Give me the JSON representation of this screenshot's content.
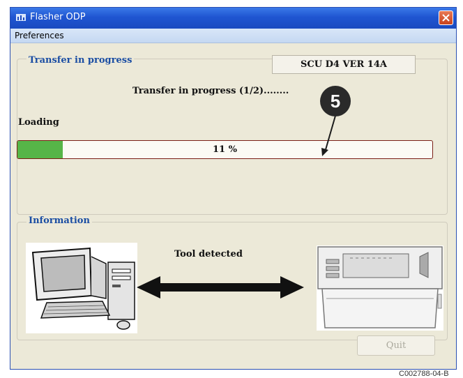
{
  "window": {
    "title": "Flasher ODP",
    "menu": [
      "Preferences"
    ]
  },
  "transfer_group": {
    "label": "Transfer in progress",
    "device_version": "SCU D4 VER  14A",
    "status_text": "Transfer in progress (1/2)........",
    "loading_label": "Loading",
    "progress_percent": 11,
    "progress_text": "11 %"
  },
  "callout": {
    "number": "5"
  },
  "information_group": {
    "label": "Information",
    "tool_status": "Tool detected"
  },
  "buttons": {
    "quit": "Quit"
  },
  "figure_ref": "C002788-04-B"
}
